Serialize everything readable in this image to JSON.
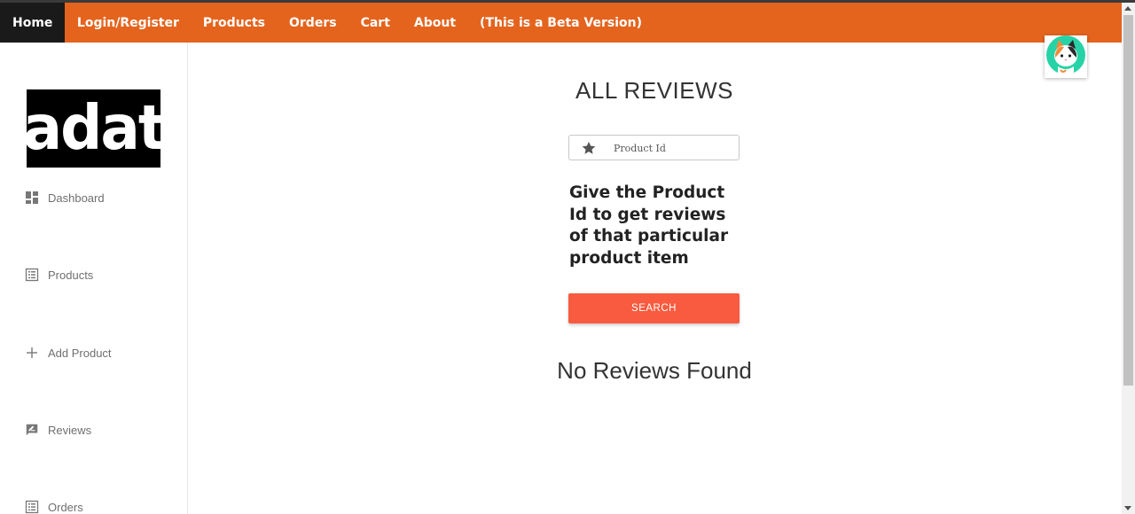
{
  "navbar": {
    "items": [
      {
        "label": "Home",
        "active": true
      },
      {
        "label": "Login/Register"
      },
      {
        "label": "Products"
      },
      {
        "label": "Orders"
      },
      {
        "label": "Cart"
      },
      {
        "label": "About"
      },
      {
        "label": "(This is a Beta Version)"
      }
    ],
    "color": "#e4641e",
    "active_color": "#1a1a1a"
  },
  "sidebar": {
    "logo_text": "adat",
    "items": [
      {
        "label": "Dashboard",
        "icon": "dashboard-icon"
      },
      {
        "label": "Products",
        "icon": "list-icon"
      },
      {
        "label": "Add Product",
        "icon": "plus-icon"
      },
      {
        "label": "Reviews",
        "icon": "rate-review-icon"
      },
      {
        "label": "Orders",
        "icon": "list-icon"
      }
    ]
  },
  "main": {
    "title": "ALL REVIEWS",
    "search_placeholder": "Product Id",
    "search_icon": "star-icon",
    "hint": "Give the Product Id to get reviews of that particular product item",
    "search_button": "SEARCH",
    "button_color": "#f85b3f",
    "empty_message": "No Reviews Found"
  },
  "avatar": {
    "icon": "cat-avatar-icon"
  }
}
